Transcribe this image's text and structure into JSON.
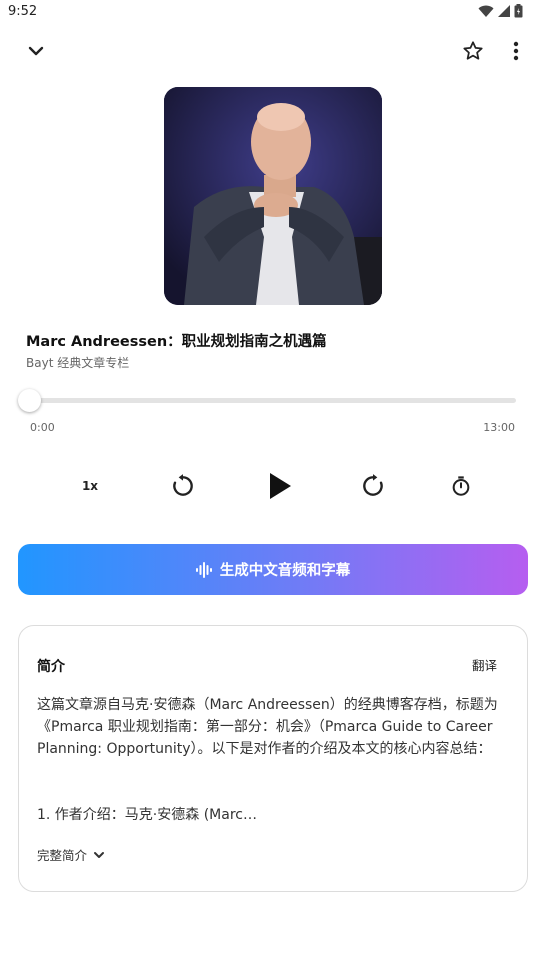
{
  "status_bar": {
    "time": "9:52",
    "icons": [
      "wifi-icon",
      "signal-icon",
      "battery-icon"
    ]
  },
  "top_bar": {
    "icons": [
      "chevron-down-icon",
      "star-icon",
      "more-vert-icon"
    ]
  },
  "episode": {
    "title": "Marc Andreessen：职业规划指南之机遇篇",
    "source": "Bayt 经典文章专栏"
  },
  "player": {
    "current_time": "0:00",
    "total_time": "13:00",
    "progress_fraction": 0,
    "speed_label": "1x",
    "controls": [
      "replay-icon",
      "play-icon",
      "forward-icon",
      "timer-icon"
    ]
  },
  "generate_button": {
    "label": "生成中文音频和字幕",
    "icon": "audio-wave-icon",
    "gradient": [
      "#2196ff",
      "#6f7cf6",
      "#b65ef0"
    ]
  },
  "intro": {
    "heading": "简介",
    "translate_label": "翻译",
    "body": "这篇文章源自马克·安德森（Marc Andreessen）的经典博客存档，标题为《Pmarca 职业规划指南：第一部分：机会》（Pmarca Guide to Career Planning: Opportunity）。以下是对作者的介绍及本文的核心内容总结：",
    "first_item": "1. 作者介绍：马克·安德森 (Marc…",
    "expand_label": "完整简介"
  }
}
